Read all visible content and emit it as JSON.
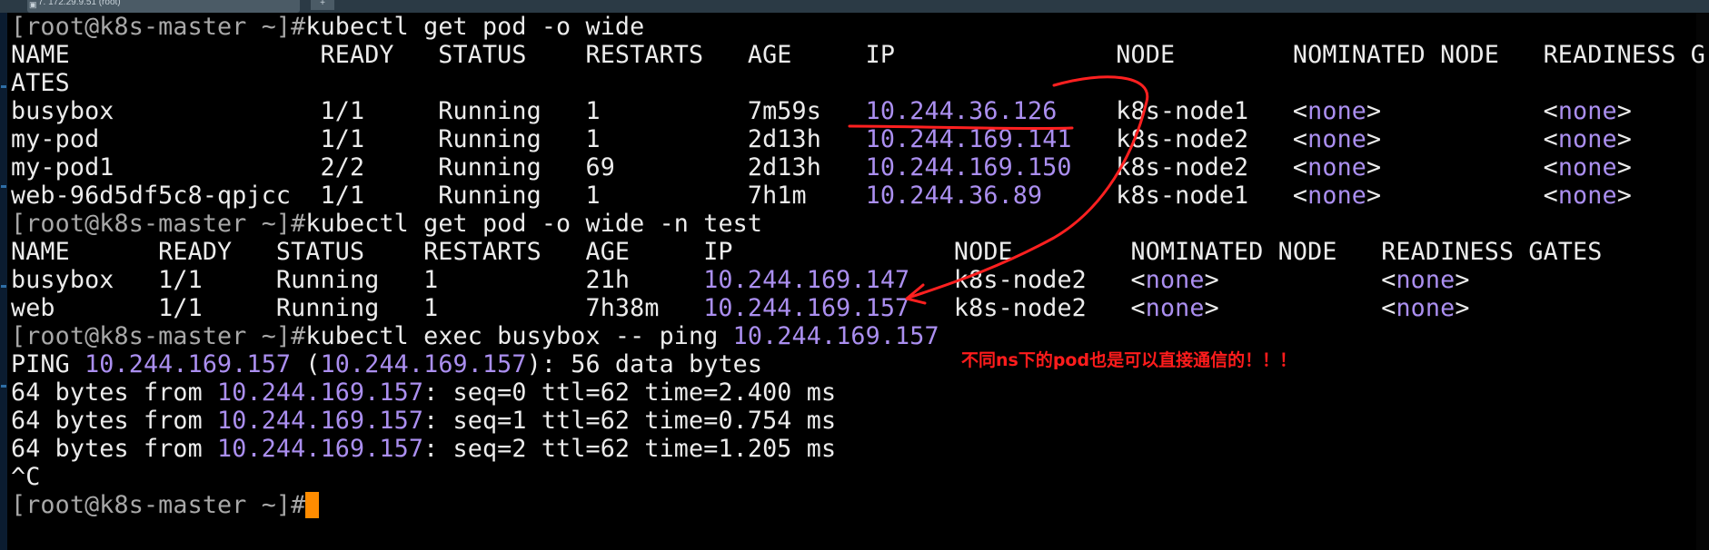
{
  "window": {
    "tab_title": "7. 172.29.9.51 (root)",
    "tab_add": "+"
  },
  "terminal": {
    "prompt": "[root@k8s-master ~]#",
    "cmd1": "kubectl get pod -o wide",
    "t1_header": "NAME                 READY   STATUS    RESTARTS   AGE     IP               NODE        NOMINATED NODE   READINESS G",
    "t1_header_wrap": "ATES",
    "t1_rows": [
      {
        "pre": "busybox              1/1     Running   1          7m59s   ",
        "ip": "10.244.36.126",
        "post": "    k8s-node1   ",
        "n1": "none",
        "mid": "           ",
        "n2": "none"
      },
      {
        "pre": "my-pod               1/1     Running   1          2d13h   ",
        "ip": "10.244.169.141",
        "post": "   k8s-node2   ",
        "n1": "none",
        "mid": "           ",
        "n2": "none"
      },
      {
        "pre": "my-pod1              2/2     Running   69         2d13h   ",
        "ip": "10.244.169.150",
        "post": "   k8s-node2   ",
        "n1": "none",
        "mid": "           ",
        "n2": "none"
      },
      {
        "pre": "web-96d5df5c8-qpjcc  1/1     Running   1          7h1m    ",
        "ip": "10.244.36.89",
        "post": "     k8s-node1   ",
        "n1": "none",
        "mid": "           ",
        "n2": "none"
      }
    ],
    "cmd2": "kubectl get pod -o wide -n test",
    "t2_header": "NAME      READY   STATUS    RESTARTS   AGE     IP               NODE        NOMINATED NODE   READINESS GATES",
    "t2_rows": [
      {
        "pre": "busybox   1/1     Running   1          21h     ",
        "ip": "10.244.169.147",
        "post": "   k8s-node2   ",
        "n1": "none",
        "mid": "           ",
        "n2": "none"
      },
      {
        "pre": "web       1/1     Running   1          7h38m   ",
        "ip": "10.244.169.157",
        "post": "   k8s-node2   ",
        "n1": "none",
        "mid": "           ",
        "n2": "none"
      }
    ],
    "cmd3": "kubectl exec busybox -- ping ",
    "cmd3_ip": "10.244.169.157",
    "ping_head": {
      "pre": "PING ",
      "ip1": "10.244.169.157",
      "mid": " (",
      "ip2": "10.244.169.157",
      "post": "): 56 data bytes"
    },
    "ping_lines": [
      {
        "pre": "64 bytes from ",
        "ip": "10.244.169.157",
        "post": ": seq=0 ttl=62 time=2.400 ms"
      },
      {
        "pre": "64 bytes from ",
        "ip": "10.244.169.157",
        "post": ": seq=1 ttl=62 time=0.754 ms"
      },
      {
        "pre": "64 bytes from ",
        "ip": "10.244.169.157",
        "post": ": seq=2 ttl=62 time=1.205 ms"
      }
    ],
    "interrupt": "^C"
  },
  "annotation": {
    "note": "不同ns下的pod也是可以直接通信的！！！",
    "color": "#ff1c1c"
  },
  "colors": {
    "background": "#000000",
    "text": "#ececec",
    "ip": "#ab8ff0",
    "cursor": "#ff8c00"
  }
}
